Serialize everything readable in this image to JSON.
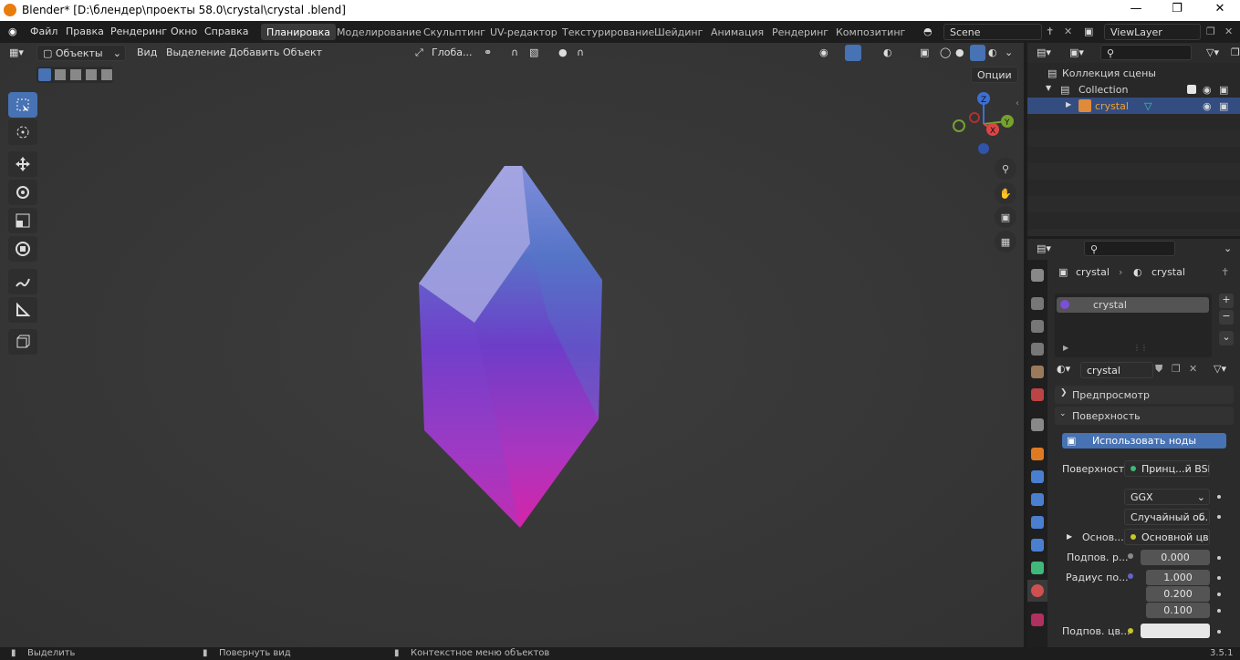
{
  "titlebar": {
    "title": "Blender* [D:\\блендер\\проекты 58.0\\crystal\\crystal .blend]"
  },
  "menu": [
    "Файл",
    "Правка",
    "Рендеринг",
    "Окно",
    "Справка"
  ],
  "workspaces": {
    "active": "Планировка",
    "items": [
      "Моделирование",
      "Скульптинг",
      "UV-редактор",
      "Текстурирование",
      "Шейдинг",
      "Анимация",
      "Рендеринг",
      "Композитинг"
    ]
  },
  "scene": "Scene",
  "view_layer": "ViewLayer",
  "viewport_header": {
    "mode": "Объекты",
    "items": [
      "Вид",
      "Выделение",
      "Добавить",
      "Объект"
    ],
    "transform": "Глоба...",
    "options": "Опции"
  },
  "outliner": {
    "root": "Коллекция сцены",
    "collection": "Collection",
    "object": "crystal"
  },
  "props": {
    "breadcrumb_obj": "crystal",
    "breadcrumb_mat": "crystal",
    "slot": "crystal",
    "material_name": "crystal",
    "preview": "Предпросмотр",
    "surface": "Поверхность",
    "use_nodes": "Использовать ноды",
    "surface_label": "Поверхность",
    "surface_value": "Принц...й BSDF",
    "dist": "GGX",
    "sss_method": "Случайный об...",
    "base_label": "Основ...",
    "base_value": "Основной цвет",
    "sss_label": "Подпов. р...",
    "sss_value": "0.000",
    "radius_label": "Радиус по...",
    "radius": [
      "1.000",
      "0.200",
      "0.100"
    ],
    "sss_color_label": "Подпов. цв..."
  },
  "status": {
    "select": "Выделить",
    "rotate": "Повернуть вид",
    "context": "Контекстное меню объектов",
    "version": "3.5.1"
  },
  "colors": {
    "accent": "#4772b3",
    "crystal_top": "#8f8fe0",
    "crystal_mid": "#6a3fc4",
    "crystal_bottom": "#d62ab0"
  }
}
